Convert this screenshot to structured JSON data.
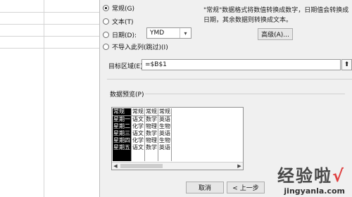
{
  "options": {
    "general": "常规(G)",
    "text": "文本(T)",
    "date": "日期(D):",
    "date_format": "YMD",
    "skip": "不导入此列(跳过)(I)"
  },
  "description": "\"常规\"数据格式将数值转换成数字，日期值会转换成日期，其余数据则转换成文本。",
  "advanced_button": "高级(A)...",
  "target": {
    "label": "目标区域(E):",
    "value": "=$B$1"
  },
  "preview": {
    "label": "数据预览(P)",
    "header": [
      "常规",
      "常规",
      "常规",
      "常规"
    ],
    "rows": [
      [
        "星期一",
        "语文",
        "数学",
        "英语"
      ],
      [
        "星期二",
        "化学",
        "物理",
        "生物"
      ],
      [
        "星期三",
        "语文",
        "数学",
        "英语"
      ],
      [
        "星期四",
        "化学",
        "物理",
        "生物"
      ],
      [
        "星期五",
        "语文",
        "数学",
        "英语"
      ]
    ]
  },
  "buttons": {
    "cancel": "取消",
    "back": "< 上一步"
  },
  "watermark": {
    "title": "经验啦",
    "check": "√",
    "url": "jingyanla.com"
  }
}
